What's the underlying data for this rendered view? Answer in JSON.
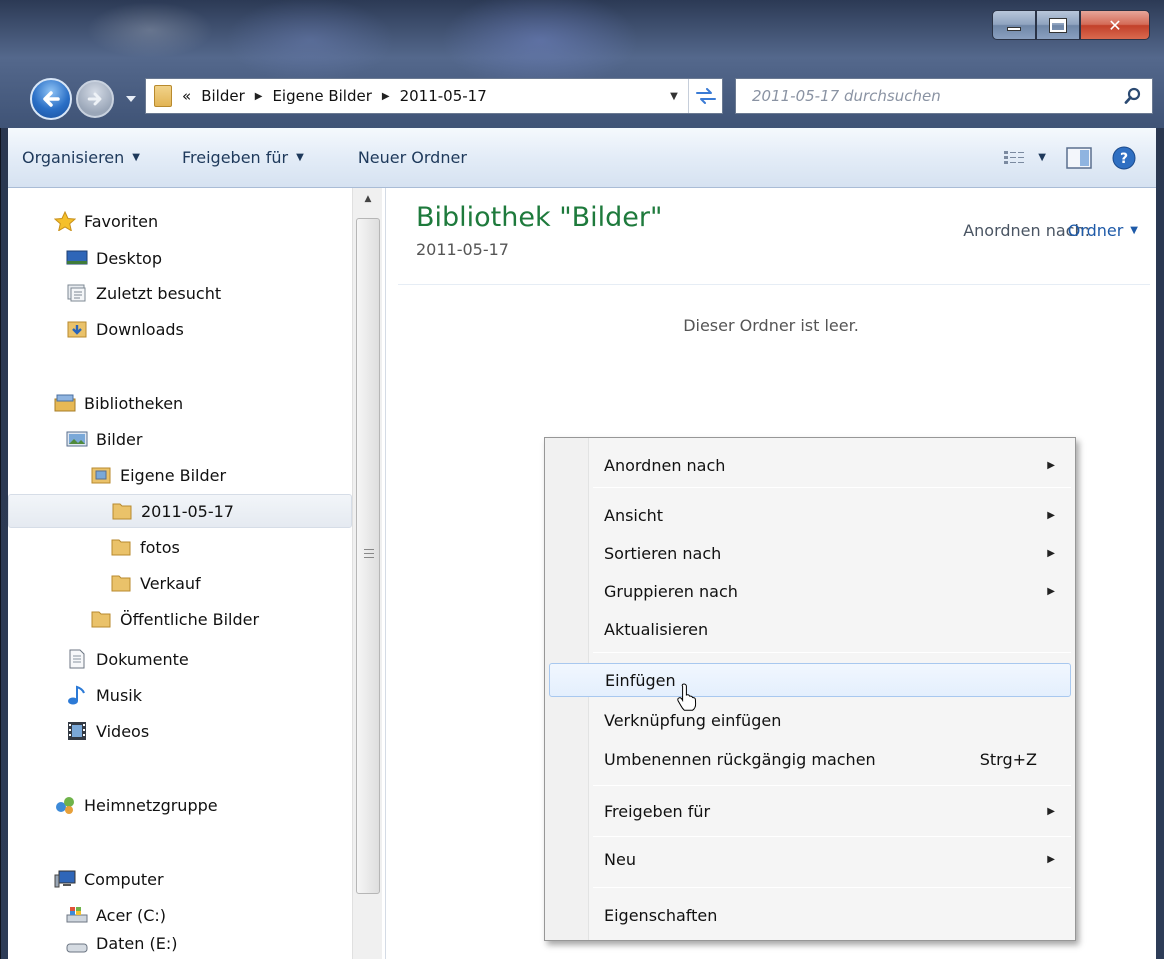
{
  "address": {
    "overflow": "«",
    "crumbs": [
      "Bilder",
      "Eigene Bilder",
      "2011-05-17"
    ]
  },
  "search": {
    "placeholder": "2011-05-17 durchsuchen"
  },
  "toolbar": {
    "organize": "Organisieren",
    "share": "Freigeben für",
    "new_folder": "Neuer Ordner"
  },
  "nav": {
    "favorites": "Favoriten",
    "desktop": "Desktop",
    "recent": "Zuletzt besucht",
    "downloads": "Downloads",
    "libraries": "Bibliotheken",
    "pictures": "Bilder",
    "my_pictures": "Eigene Bilder",
    "folder_selected": "2011-05-17",
    "folder_fotos": "fotos",
    "folder_verkauf": "Verkauf",
    "public_pictures": "Öffentliche Bilder",
    "documents": "Dokumente",
    "music": "Musik",
    "videos": "Videos",
    "homegroup": "Heimnetzgruppe",
    "computer": "Computer",
    "drive_c": "Acer (C:)",
    "drive_e": "Daten (E:)"
  },
  "content": {
    "library_title": "Bibliothek \"Bilder\"",
    "library_sub": "2011-05-17",
    "arrange_label": "Anordnen nach:",
    "arrange_value": "Ordner",
    "empty_message": "Dieser Ordner ist leer."
  },
  "context_menu": {
    "arrange_by": "Anordnen nach",
    "view": "Ansicht",
    "sort_by": "Sortieren nach",
    "group_by": "Gruppieren nach",
    "refresh": "Aktualisieren",
    "paste": "Einfügen",
    "paste_shortcut": "Verknüpfung einfügen",
    "undo_rename": "Umbenennen rückgängig machen",
    "undo_shortcut": "Strg+Z",
    "share_with": "Freigeben für",
    "new": "Neu",
    "properties": "Eigenschaften"
  }
}
